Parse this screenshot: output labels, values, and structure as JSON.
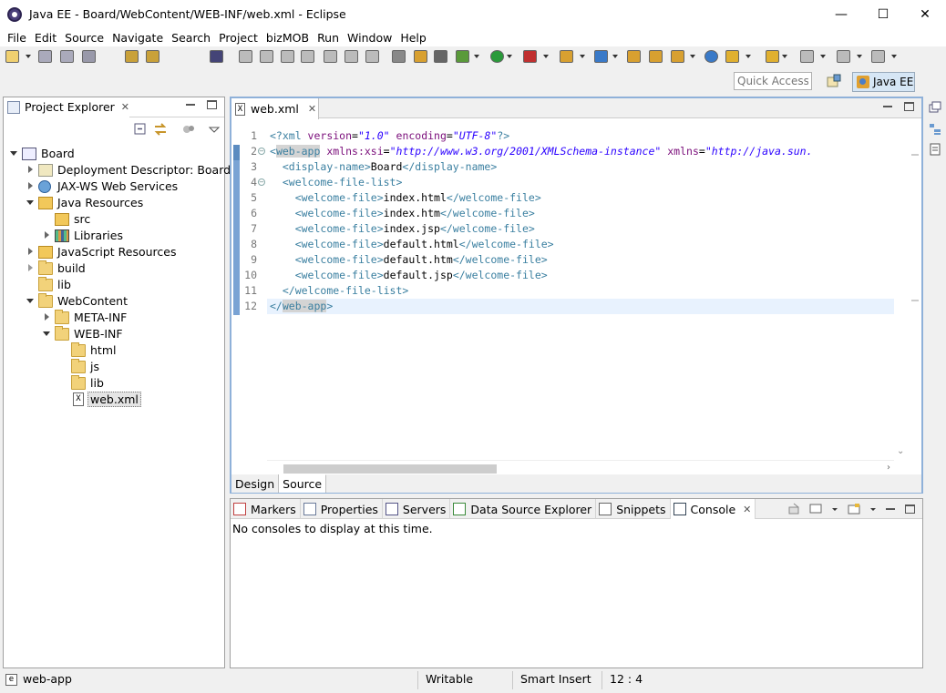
{
  "window": {
    "title": "Java EE - Board/WebContent/WEB-INF/web.xml - Eclipse",
    "controls": {
      "minimize": "—",
      "maximize": "☐",
      "close": "✕"
    }
  },
  "menu": [
    "File",
    "Edit",
    "Source",
    "Navigate",
    "Search",
    "Project",
    "bizMOB",
    "Run",
    "Window",
    "Help"
  ],
  "toolbar": {
    "quick_access_placeholder": "Quick Access",
    "perspective_label": "Java EE"
  },
  "explorer": {
    "tab_label": "Project Explorer",
    "close_glyph": "✕",
    "tree": [
      {
        "label": "Board",
        "depth": 0,
        "state": "expanded",
        "icon": "project-icon"
      },
      {
        "label": "Deployment Descriptor: Board",
        "depth": 1,
        "state": "collapsed",
        "icon": "deployment-descriptor-icon"
      },
      {
        "label": "JAX-WS Web Services",
        "depth": 1,
        "state": "collapsed",
        "icon": "web-services-icon"
      },
      {
        "label": "Java Resources",
        "depth": 1,
        "state": "expanded",
        "icon": "java-resources-icon"
      },
      {
        "label": "src",
        "depth": 2,
        "state": "none",
        "icon": "source-folder-icon"
      },
      {
        "label": "Libraries",
        "depth": 2,
        "state": "collapsed",
        "icon": "libraries-icon"
      },
      {
        "label": "JavaScript Resources",
        "depth": 1,
        "state": "collapsed",
        "icon": "javascript-resources-icon"
      },
      {
        "label": "build",
        "depth": 1,
        "state": "collapsed-hollow",
        "icon": "folder-icon"
      },
      {
        "label": "lib",
        "depth": 1,
        "state": "none",
        "icon": "folder-icon"
      },
      {
        "label": "WebContent",
        "depth": 1,
        "state": "expanded",
        "icon": "folder-icon"
      },
      {
        "label": "META-INF",
        "depth": 2,
        "state": "collapsed",
        "icon": "folder-icon"
      },
      {
        "label": "WEB-INF",
        "depth": 2,
        "state": "expanded",
        "icon": "folder-icon"
      },
      {
        "label": "html",
        "depth": 3,
        "state": "none",
        "icon": "folder-icon"
      },
      {
        "label": "js",
        "depth": 3,
        "state": "none",
        "icon": "folder-icon"
      },
      {
        "label": "lib",
        "depth": 3,
        "state": "none",
        "icon": "folder-icon"
      },
      {
        "label": "web.xml",
        "depth": 3,
        "state": "none",
        "icon": "xml-file-icon",
        "selected": true
      }
    ]
  },
  "editor": {
    "tab_label": "web.xml",
    "close_glyph": "✕",
    "line_numbers": [
      "1",
      "2",
      "3",
      "4",
      "5",
      "6",
      "7",
      "8",
      "9",
      "10",
      "11",
      "12"
    ],
    "fold_markers": {
      "2": "−",
      "4": "−"
    },
    "lines": [
      [
        {
          "c": "tag",
          "t": "<?xml "
        },
        {
          "c": "attr",
          "t": "version"
        },
        {
          "c": "txt",
          "t": "="
        },
        {
          "c": "str",
          "t": "\"1.0\""
        },
        {
          "c": "txt",
          "t": " "
        },
        {
          "c": "attr",
          "t": "encoding"
        },
        {
          "c": "txt",
          "t": "="
        },
        {
          "c": "str",
          "t": "\"UTF-8\""
        },
        {
          "c": "tag",
          "t": "?>"
        }
      ],
      [
        {
          "c": "tag",
          "t": "<"
        },
        {
          "c": "tag hl",
          "t": "web-app"
        },
        {
          "c": "txt",
          "t": " "
        },
        {
          "c": "attr",
          "t": "xmlns:xsi"
        },
        {
          "c": "txt",
          "t": "="
        },
        {
          "c": "str",
          "t": "\"http://www.w3.org/2001/XMLSchema-instance\""
        },
        {
          "c": "txt",
          "t": " "
        },
        {
          "c": "attr",
          "t": "xmlns"
        },
        {
          "c": "txt",
          "t": "="
        },
        {
          "c": "str",
          "t": "\"http://java.sun."
        }
      ],
      [
        {
          "c": "txt",
          "t": "  "
        },
        {
          "c": "tag",
          "t": "<display-name>"
        },
        {
          "c": "txt",
          "t": "Board"
        },
        {
          "c": "tag",
          "t": "</display-name>"
        }
      ],
      [
        {
          "c": "txt",
          "t": "  "
        },
        {
          "c": "tag",
          "t": "<welcome-file-list>"
        }
      ],
      [
        {
          "c": "txt",
          "t": "    "
        },
        {
          "c": "tag",
          "t": "<welcome-file>"
        },
        {
          "c": "txt",
          "t": "index.html"
        },
        {
          "c": "tag",
          "t": "</welcome-file>"
        }
      ],
      [
        {
          "c": "txt",
          "t": "    "
        },
        {
          "c": "tag",
          "t": "<welcome-file>"
        },
        {
          "c": "txt",
          "t": "index.htm"
        },
        {
          "c": "tag",
          "t": "</welcome-file>"
        }
      ],
      [
        {
          "c": "txt",
          "t": "    "
        },
        {
          "c": "tag",
          "t": "<welcome-file>"
        },
        {
          "c": "txt",
          "t": "index.jsp"
        },
        {
          "c": "tag",
          "t": "</welcome-file>"
        }
      ],
      [
        {
          "c": "txt",
          "t": "    "
        },
        {
          "c": "tag",
          "t": "<welcome-file>"
        },
        {
          "c": "txt",
          "t": "default.html"
        },
        {
          "c": "tag",
          "t": "</welcome-file>"
        }
      ],
      [
        {
          "c": "txt",
          "t": "    "
        },
        {
          "c": "tag",
          "t": "<welcome-file>"
        },
        {
          "c": "txt",
          "t": "default.htm"
        },
        {
          "c": "tag",
          "t": "</welcome-file>"
        }
      ],
      [
        {
          "c": "txt",
          "t": "    "
        },
        {
          "c": "tag",
          "t": "<welcome-file>"
        },
        {
          "c": "txt",
          "t": "default.jsp"
        },
        {
          "c": "tag",
          "t": "</welcome-file>"
        }
      ],
      [
        {
          "c": "txt",
          "t": "  "
        },
        {
          "c": "tag",
          "t": "</welcome-file-list>"
        }
      ],
      [
        {
          "c": "tag",
          "t": "</"
        },
        {
          "c": "tag hl",
          "t": "web-app"
        },
        {
          "c": "tag",
          "t": ">"
        }
      ]
    ],
    "current_line": 12,
    "bottom_tabs": [
      "Design",
      "Source"
    ],
    "active_bottom_tab": "Source"
  },
  "console": {
    "tabs": [
      {
        "label": "Markers",
        "icon": "markers-icon"
      },
      {
        "label": "Properties",
        "icon": "properties-icon"
      },
      {
        "label": "Servers",
        "icon": "servers-icon"
      },
      {
        "label": "Data Source Explorer",
        "icon": "data-source-explorer-icon"
      },
      {
        "label": "Snippets",
        "icon": "snippets-icon"
      },
      {
        "label": "Console",
        "icon": "console-icon",
        "active": true
      }
    ],
    "close_glyph": "✕",
    "message": "No consoles to display at this time."
  },
  "statusbar": {
    "selection": "web-app",
    "writable": "Writable",
    "insert_mode": "Smart Insert",
    "cursor_position": "12 : 4"
  },
  "colors": {
    "tag": "#3a7fa0",
    "attribute": "#7a0d7a",
    "string": "#2a00ff",
    "active_border": "#8fb1d9"
  }
}
